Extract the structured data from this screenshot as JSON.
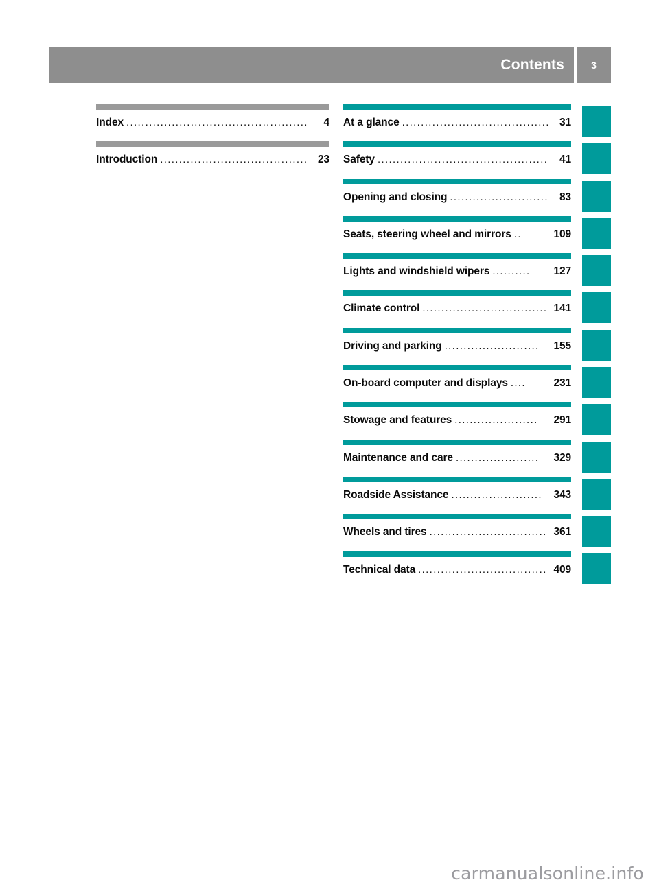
{
  "header": {
    "title": "Contents",
    "page_number": "3",
    "bar_color": "#8e8e8e"
  },
  "colors": {
    "teal": "#009b9b",
    "gray": "#9a9a9a",
    "header_gray": "#8e8e8e",
    "text": "#0b0b0b",
    "watermark": "#9c9ca0"
  },
  "left_column": {
    "rule_color": "#9a9a9a",
    "entries": [
      {
        "label": "Index",
        "dots": "......................................................",
        "page": "4"
      },
      {
        "label": "Introduction",
        "dots": "........................................",
        "page": "23"
      }
    ]
  },
  "right_column": {
    "rule_color": "#009b9b",
    "entries": [
      {
        "label": "At a glance",
        "dots": "...........................................",
        "page": "31"
      },
      {
        "label": "Safety",
        "dots": "...................................................",
        "page": "41"
      },
      {
        "label": "Opening and closing",
        "dots": "...........................",
        "page": "83"
      },
      {
        "label": "Seats, steering wheel and mirrors",
        "dots": "..",
        "page": "109"
      },
      {
        "label": "Lights and windshield wipers",
        "dots": "..........",
        "page": "127"
      },
      {
        "label": "Climate control",
        "dots": ".................................",
        "page": "141"
      },
      {
        "label": "Driving and parking",
        "dots": ".........................",
        "page": "155"
      },
      {
        "label": "On-board computer and displays",
        "dots": "....",
        "page": "231"
      },
      {
        "label": "Stowage and features",
        "dots": "......................",
        "page": "291"
      },
      {
        "label": "Maintenance and care",
        "dots": "......................",
        "page": "329"
      },
      {
        "label": "Roadside Assistance",
        "dots": "........................",
        "page": "343"
      },
      {
        "label": "Wheels and tires",
        "dots": "...............................",
        "page": "361"
      },
      {
        "label": "Technical data",
        "dots": "...................................",
        "page": "409"
      }
    ]
  },
  "side_tabs": {
    "count": 13,
    "color": "#009b9b"
  },
  "watermark": {
    "text": "carmanualsonline.info"
  }
}
